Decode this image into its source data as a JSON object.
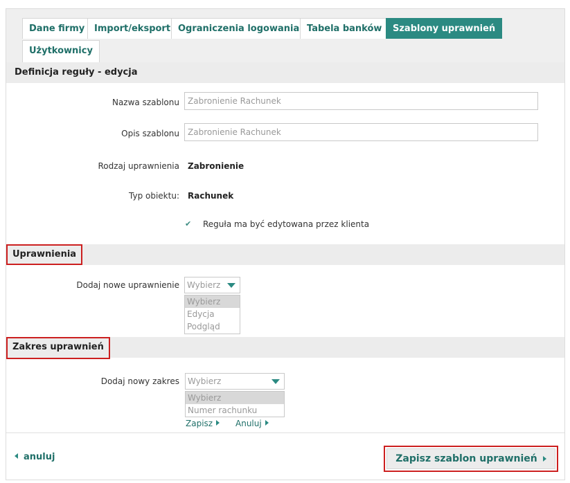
{
  "tabs": [
    {
      "label": "Dane firmy",
      "active": false
    },
    {
      "label": "Import/eksport",
      "active": false
    },
    {
      "label": "Ograniczenia logowania",
      "active": false
    },
    {
      "label": "Tabela banków",
      "active": false
    },
    {
      "label": "Szablony uprawnień",
      "active": true
    },
    {
      "label": "Użytkownicy",
      "active": false
    }
  ],
  "rule_section": {
    "title": "Definicja reguły - edycja"
  },
  "form": {
    "template_name_label": "Nazwa szablonu",
    "template_name_value": "Zabronienie Rachunek",
    "template_desc_label": "Opis szablonu",
    "template_desc_value": "Zabronienie Rachunek",
    "permission_type_label": "Rodzaj uprawnienia",
    "permission_type_value": "Zabronienie",
    "object_type_label": "Typ obiektu:",
    "object_type_value": "Rachunek",
    "editable_checkbox_label": "Reguła ma być edytowana przez klienta",
    "editable_checked": true
  },
  "permissions_section": {
    "title": "Uprawnienia",
    "add_label": "Dodaj nowe uprawnienie",
    "select_value": "Wybierz",
    "options": [
      "Wybierz",
      "Edycja",
      "Podgląd"
    ]
  },
  "scope_section": {
    "title": "Zakres uprawnień",
    "add_label": "Dodaj nowy zakres",
    "select_value": "Wybierz",
    "options": [
      "Wybierz",
      "Numer rachunku"
    ],
    "save_link": "Zapisz",
    "cancel_link": "Anuluj"
  },
  "footer": {
    "cancel_label": "anuluj",
    "save_label": "Zapisz szablon uprawnień"
  },
  "colors": {
    "accent": "#2b8a82",
    "highlight": "#cc1f1f"
  }
}
